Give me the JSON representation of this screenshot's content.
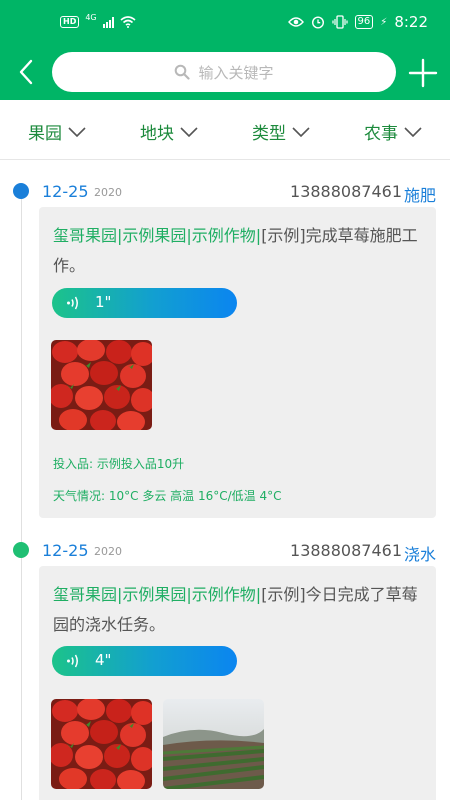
{
  "status_bar": {
    "hd": "HD",
    "network": "4G",
    "battery": "96",
    "time": "8:22"
  },
  "header": {
    "search_placeholder": "输入关键字",
    "back_icon": "chevron-left-icon",
    "add_icon": "plus-icon",
    "bg_color": "#00b566"
  },
  "filters": [
    {
      "label": "果园"
    },
    {
      "label": "地块"
    },
    {
      "label": "类型"
    },
    {
      "label": "农事"
    }
  ],
  "records": [
    {
      "date": "12-25",
      "year": "2020",
      "phone": "13888087461",
      "type": "施肥",
      "dot_color": "#1a7fd9",
      "path": "玺哥果园|示例果园|示例作物|",
      "text": "[示例]完成草莓施肥工作。",
      "voice_duration": "1\"",
      "photos": [
        "strawberries"
      ],
      "inputs": "投入品: 示例投入品10升",
      "weather": "天气情况: 10°C 多云 高温 16°C/低温 4°C"
    },
    {
      "date": "12-25",
      "year": "2020",
      "phone": "13888087461",
      "type": "浇水",
      "dot_color": "#1fbf73",
      "path": "玺哥果园|示例果园|示例作物|",
      "text": "[示例]今日完成了草莓园的浇水任务。",
      "voice_duration": "4\"",
      "photos": [
        "strawberries",
        "farmland"
      ]
    }
  ]
}
